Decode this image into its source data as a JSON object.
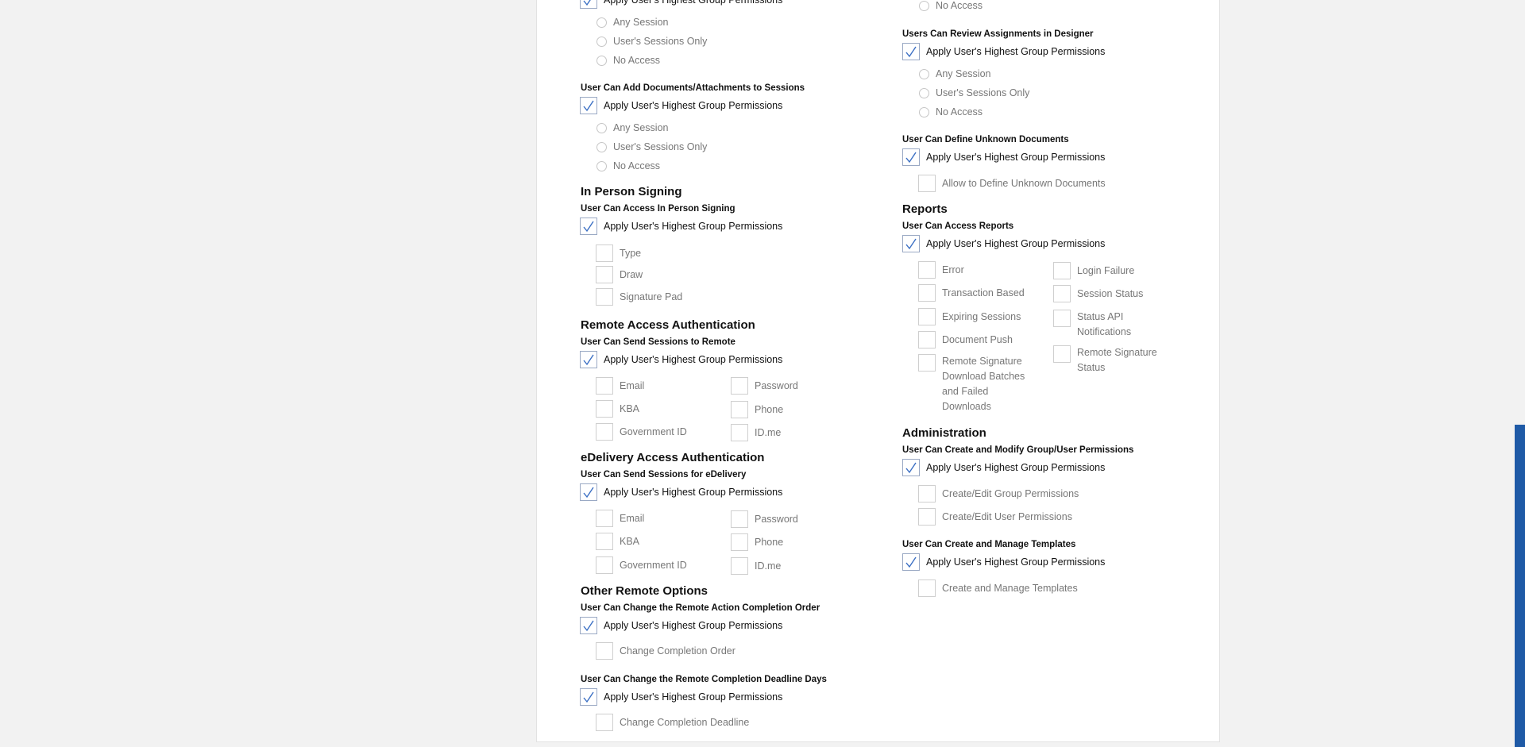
{
  "apply_label": "Apply User's Highest Group Permissions",
  "session_options": [
    "Any Session",
    "User's Sessions Only",
    "No Access"
  ],
  "no_access_label": "No Access",
  "left": {
    "add_docs": {
      "title": "User Can Add Documents/Attachments to Sessions"
    },
    "in_person": {
      "section": "In Person Signing",
      "title": "User Can Access In Person Signing",
      "options": [
        "Type",
        "Draw",
        "Signature Pad"
      ]
    },
    "remote_auth": {
      "section": "Remote Access Authentication",
      "title": "User Can Send Sessions to Remote",
      "col1": [
        "Email",
        "KBA",
        "Government ID"
      ],
      "col2": [
        "Password",
        "Phone",
        "ID.me"
      ]
    },
    "edelivery_auth": {
      "section": "eDelivery Access Authentication",
      "title": "User Can Send Sessions for eDelivery",
      "col1": [
        "Email",
        "KBA",
        "Government ID"
      ],
      "col2": [
        "Password",
        "Phone",
        "ID.me"
      ]
    },
    "other_remote": {
      "section": "Other Remote Options",
      "order_title": "User Can Change the Remote Action Completion Order",
      "order_option": "Change Completion Order",
      "deadline_title": "User Can Change the Remote Completion Deadline Days",
      "deadline_option": "Change Completion Deadline"
    }
  },
  "right": {
    "review": {
      "title": "Users Can Review Assignments in Designer"
    },
    "define_unknown": {
      "title": "User Can Define Unknown Documents",
      "option": "Allow to Define Unknown Documents"
    },
    "reports": {
      "section": "Reports",
      "title": "User Can Access Reports",
      "col1": [
        "Error",
        "Transaction Based",
        "Expiring Sessions",
        "Document Push",
        "Remote Signature Download Batches and Failed Downloads"
      ],
      "col2": [
        "Login Failure",
        "Session Status",
        "Status API Notifications",
        "Remote Signature Status"
      ]
    },
    "admin": {
      "section": "Administration",
      "title": "User Can Create and Modify Group/User Permissions",
      "options": [
        "Create/Edit Group Permissions",
        "Create/Edit User Permissions"
      ]
    },
    "templates": {
      "title": "User Can Create and Manage Templates",
      "option": "Create and Manage Templates"
    }
  }
}
